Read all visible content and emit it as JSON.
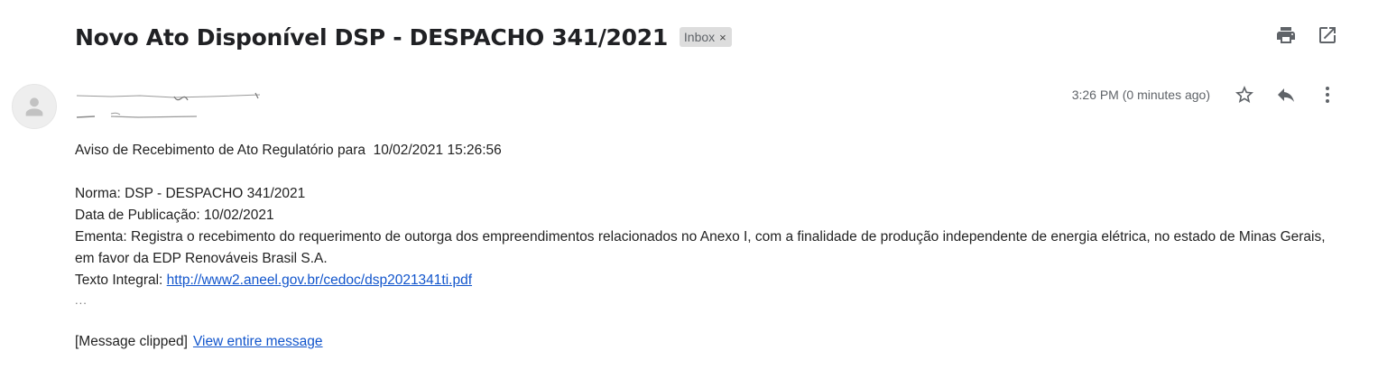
{
  "email": {
    "subject": "Novo Ato Disponível DSP - DESPACHO 341/2021",
    "label": {
      "name": "Inbox",
      "remove_glyph": "×"
    },
    "timestamp": "3:26 PM (0 minutes ago)"
  },
  "icons": {
    "print": "print-icon",
    "open_new_window": "open-in-new-window-icon",
    "star": "star-icon",
    "reply": "reply-icon",
    "more": "more-vertical-icon",
    "avatar": "default-avatar-icon"
  },
  "body": {
    "intro": "Aviso de Recebimento de Ato Regulatório para  10/02/2021 15:26:56",
    "norma": "Norma: DSP - DESPACHO 341/2021",
    "data_publicacao": "Data de Publicação: 10/02/2021",
    "ementa": "Ementa: Registra o recebimento do requerimento de outorga dos empreendimentos relacionados no Anexo I, com a finalidade de produção independente de energia elétrica, no estado de Minas Gerais, em favor da EDP Renováveis Brasil S.A.",
    "texto_integral_label": "Texto Integral: ",
    "texto_integral_link": "http://www2.aneel.gov.br/cedoc/dsp2021341ti.pdf",
    "ellipsis": "...",
    "clipped_label": "[Message clipped]",
    "view_entire_link": "View entire message"
  },
  "colors": {
    "link": "#1155cc",
    "secondary_text": "#5f6368",
    "chip_bg": "#dddddd",
    "icon": "#5f6368"
  }
}
